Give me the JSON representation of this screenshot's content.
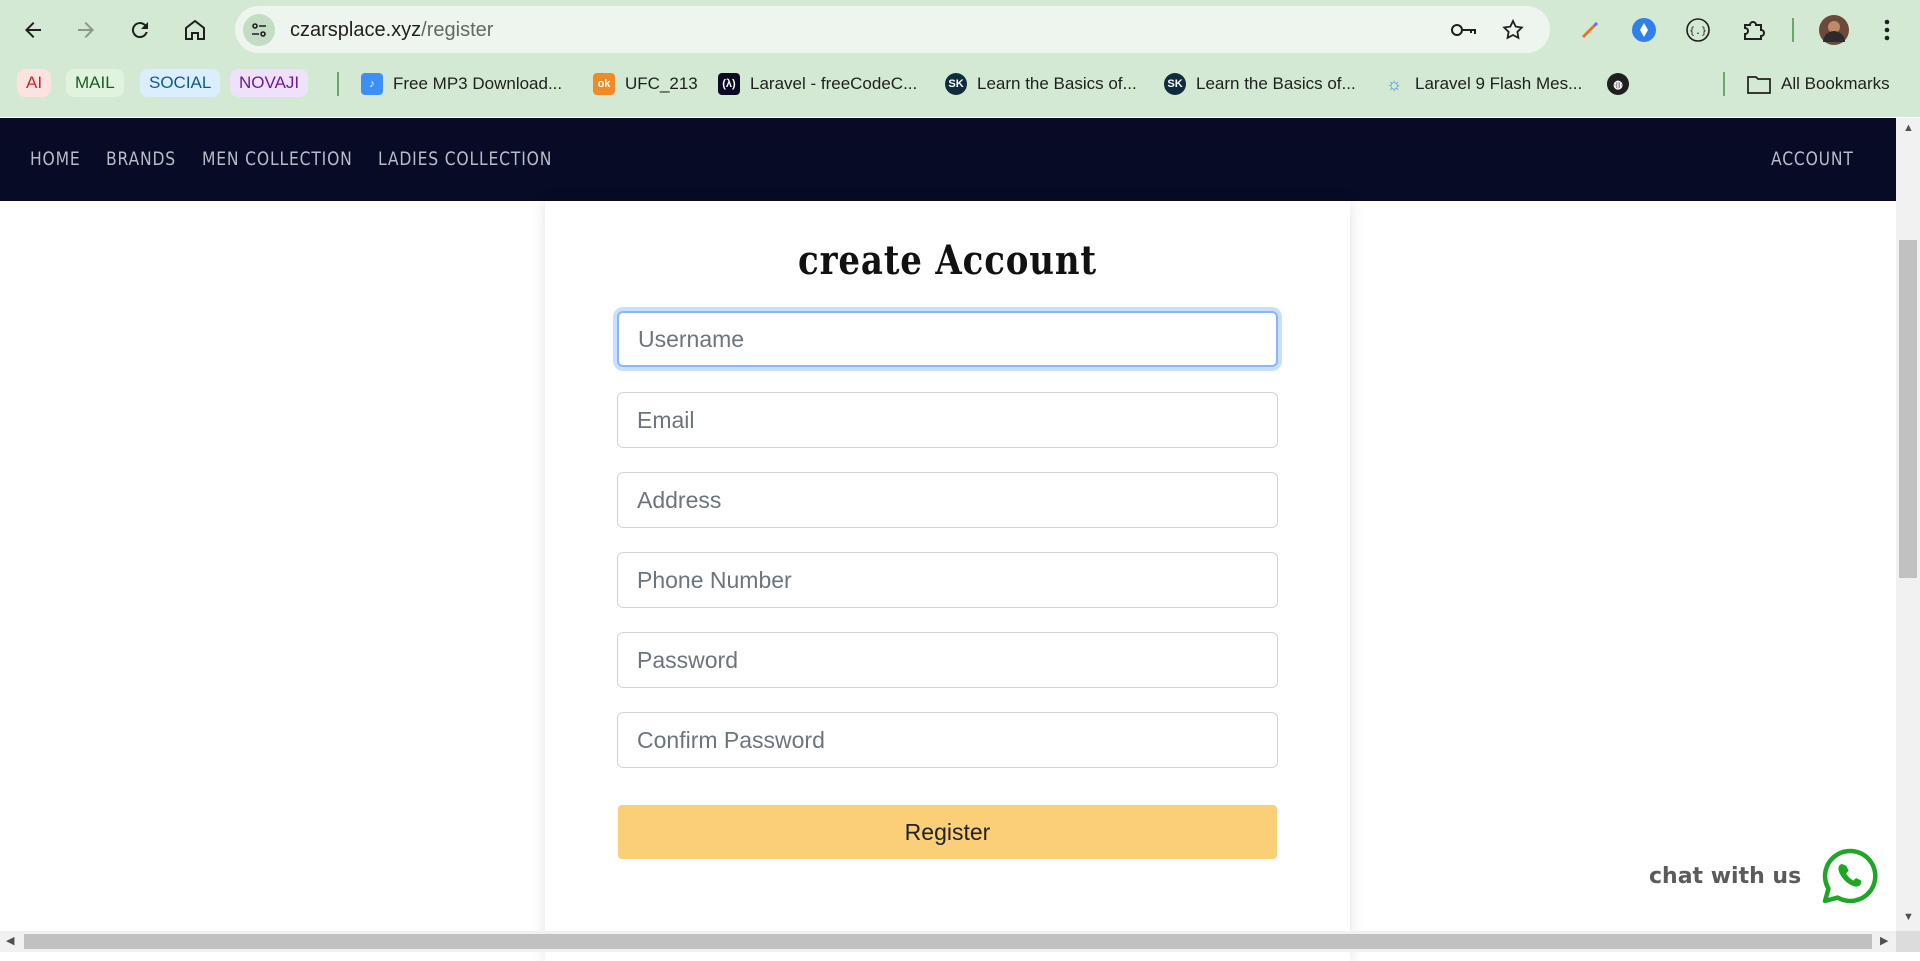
{
  "browser": {
    "url_host": "czarsplace.xyz",
    "url_path": "/register",
    "bookmark_chips": [
      {
        "label": "AI",
        "bg": "#fde2e2",
        "color": "#c62828"
      },
      {
        "label": "MAIL",
        "bg": "#dff3df",
        "color": "#1b5e20"
      },
      {
        "label": "SOCIAL",
        "bg": "#dbeefe",
        "color": "#0d5c8c"
      },
      {
        "label": "NOVAJI",
        "bg": "#efe0fb",
        "color": "#6a1b9a"
      }
    ],
    "bookmarks": [
      {
        "label": "Free MP3 Download...",
        "icon": "music-note-icon"
      },
      {
        "label": "UFC_213",
        "icon": "ok-icon"
      },
      {
        "label": "Laravel - freeCodeC...",
        "icon": "freecodecamp-icon"
      },
      {
        "label": "Learn the Basics of...",
        "icon": "sk-icon"
      },
      {
        "label": "Learn the Basics of...",
        "icon": "sk-icon"
      },
      {
        "label": "Laravel 9 Flash Mes...",
        "icon": "lightbulb-icon"
      }
    ],
    "all_bookmarks": "All Bookmarks"
  },
  "site": {
    "nav": {
      "home": "HOME",
      "brands": "BRANDS",
      "men": "MEN COLLECTION",
      "ladies": "LADIES COLLECTION",
      "account": "ACCOUNT"
    },
    "colors": {
      "navbar": "#070b25",
      "register_button": "#fbcf78",
      "whatsapp": "#1fa626"
    }
  },
  "form": {
    "title": "create Account",
    "fields": {
      "username": "Username",
      "email": "Email",
      "address": "Address",
      "phone": "Phone Number",
      "password": "Password",
      "confirm": "Confirm Password"
    },
    "submit": "Register"
  },
  "chat": {
    "label": "chat with us",
    "icon": "whatsapp-icon"
  }
}
